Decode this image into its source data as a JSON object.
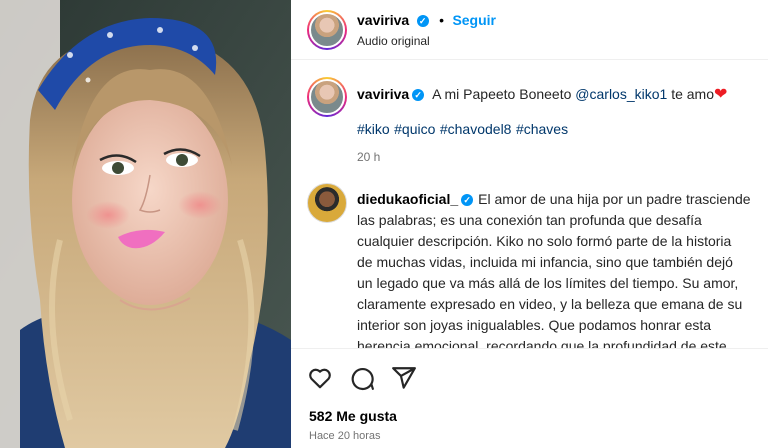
{
  "post": {
    "media_alt": "photo",
    "author": {
      "username": "vaviriva",
      "verified": true,
      "follow_label": "Seguir",
      "separator": "•",
      "audio_label": "Audio original"
    },
    "caption": {
      "username": "vaviriva",
      "text_before": "A mi Papeeto Boneeto",
      "mention": "@carlos_kiko1",
      "text_after": "te amo",
      "heart": "❤",
      "hashtags": [
        "#kiko",
        "#quico",
        "#chavodel8",
        "#chaves"
      ],
      "time": "20 h"
    },
    "comment": {
      "username": "diedukaoficial_",
      "verified": true,
      "lines": [
        "El amor de una hija por un padre trasciende",
        "las palabras; es una conexión tan profunda que desafía",
        "cualquier descripción. Kiko no solo formó parte de la historia",
        "de muchas vidas, incluida mi infancia, sino que también dejó",
        "un legado que va más allá de los límites del tiempo. Su amor,",
        "claramente expresado en video, y la belleza que emana de su",
        "interior son joyas inigualables. Que podamos honrar esta",
        "herencia emocional, recordando que la profundidad de este"
      ]
    },
    "actions": {
      "likes": "582 Me gusta",
      "posted_ago": "Hace 20 horas",
      "icons": [
        "heart-icon",
        "comment-icon",
        "share-icon"
      ]
    },
    "colors": {
      "link": "#00376b",
      "follow": "#0095f6",
      "verified": "#0095f6",
      "heart": "#ed1c24"
    }
  }
}
